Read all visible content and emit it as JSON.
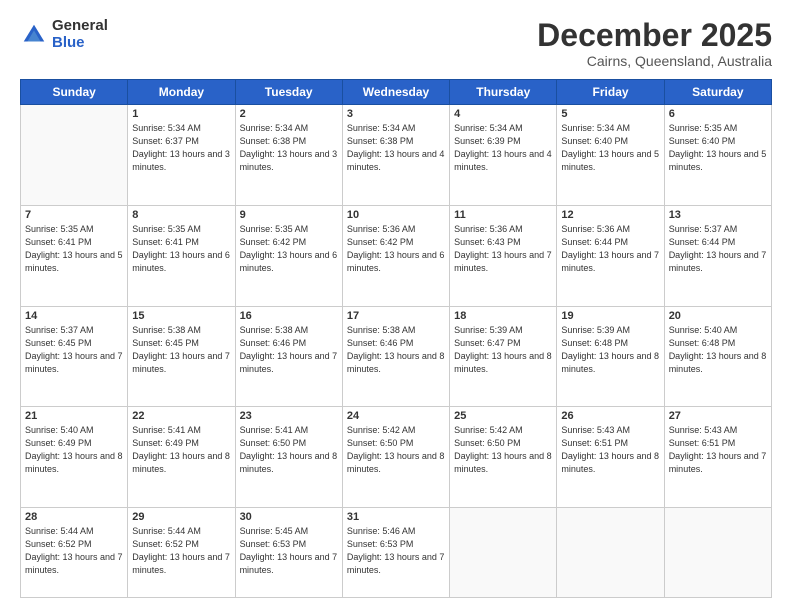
{
  "logo": {
    "general": "General",
    "blue": "Blue"
  },
  "header": {
    "month": "December 2025",
    "location": "Cairns, Queensland, Australia"
  },
  "days_of_week": [
    "Sunday",
    "Monday",
    "Tuesday",
    "Wednesday",
    "Thursday",
    "Friday",
    "Saturday"
  ],
  "weeks": [
    [
      {
        "day": "",
        "sunrise": "",
        "sunset": "",
        "daylight": ""
      },
      {
        "day": "1",
        "sunrise": "Sunrise: 5:34 AM",
        "sunset": "Sunset: 6:37 PM",
        "daylight": "Daylight: 13 hours and 3 minutes."
      },
      {
        "day": "2",
        "sunrise": "Sunrise: 5:34 AM",
        "sunset": "Sunset: 6:38 PM",
        "daylight": "Daylight: 13 hours and 3 minutes."
      },
      {
        "day": "3",
        "sunrise": "Sunrise: 5:34 AM",
        "sunset": "Sunset: 6:38 PM",
        "daylight": "Daylight: 13 hours and 4 minutes."
      },
      {
        "day": "4",
        "sunrise": "Sunrise: 5:34 AM",
        "sunset": "Sunset: 6:39 PM",
        "daylight": "Daylight: 13 hours and 4 minutes."
      },
      {
        "day": "5",
        "sunrise": "Sunrise: 5:34 AM",
        "sunset": "Sunset: 6:40 PM",
        "daylight": "Daylight: 13 hours and 5 minutes."
      },
      {
        "day": "6",
        "sunrise": "Sunrise: 5:35 AM",
        "sunset": "Sunset: 6:40 PM",
        "daylight": "Daylight: 13 hours and 5 minutes."
      }
    ],
    [
      {
        "day": "7",
        "sunrise": "Sunrise: 5:35 AM",
        "sunset": "Sunset: 6:41 PM",
        "daylight": "Daylight: 13 hours and 5 minutes."
      },
      {
        "day": "8",
        "sunrise": "Sunrise: 5:35 AM",
        "sunset": "Sunset: 6:41 PM",
        "daylight": "Daylight: 13 hours and 6 minutes."
      },
      {
        "day": "9",
        "sunrise": "Sunrise: 5:35 AM",
        "sunset": "Sunset: 6:42 PM",
        "daylight": "Daylight: 13 hours and 6 minutes."
      },
      {
        "day": "10",
        "sunrise": "Sunrise: 5:36 AM",
        "sunset": "Sunset: 6:42 PM",
        "daylight": "Daylight: 13 hours and 6 minutes."
      },
      {
        "day": "11",
        "sunrise": "Sunrise: 5:36 AM",
        "sunset": "Sunset: 6:43 PM",
        "daylight": "Daylight: 13 hours and 7 minutes."
      },
      {
        "day": "12",
        "sunrise": "Sunrise: 5:36 AM",
        "sunset": "Sunset: 6:44 PM",
        "daylight": "Daylight: 13 hours and 7 minutes."
      },
      {
        "day": "13",
        "sunrise": "Sunrise: 5:37 AM",
        "sunset": "Sunset: 6:44 PM",
        "daylight": "Daylight: 13 hours and 7 minutes."
      }
    ],
    [
      {
        "day": "14",
        "sunrise": "Sunrise: 5:37 AM",
        "sunset": "Sunset: 6:45 PM",
        "daylight": "Daylight: 13 hours and 7 minutes."
      },
      {
        "day": "15",
        "sunrise": "Sunrise: 5:38 AM",
        "sunset": "Sunset: 6:45 PM",
        "daylight": "Daylight: 13 hours and 7 minutes."
      },
      {
        "day": "16",
        "sunrise": "Sunrise: 5:38 AM",
        "sunset": "Sunset: 6:46 PM",
        "daylight": "Daylight: 13 hours and 7 minutes."
      },
      {
        "day": "17",
        "sunrise": "Sunrise: 5:38 AM",
        "sunset": "Sunset: 6:46 PM",
        "daylight": "Daylight: 13 hours and 8 minutes."
      },
      {
        "day": "18",
        "sunrise": "Sunrise: 5:39 AM",
        "sunset": "Sunset: 6:47 PM",
        "daylight": "Daylight: 13 hours and 8 minutes."
      },
      {
        "day": "19",
        "sunrise": "Sunrise: 5:39 AM",
        "sunset": "Sunset: 6:48 PM",
        "daylight": "Daylight: 13 hours and 8 minutes."
      },
      {
        "day": "20",
        "sunrise": "Sunrise: 5:40 AM",
        "sunset": "Sunset: 6:48 PM",
        "daylight": "Daylight: 13 hours and 8 minutes."
      }
    ],
    [
      {
        "day": "21",
        "sunrise": "Sunrise: 5:40 AM",
        "sunset": "Sunset: 6:49 PM",
        "daylight": "Daylight: 13 hours and 8 minutes."
      },
      {
        "day": "22",
        "sunrise": "Sunrise: 5:41 AM",
        "sunset": "Sunset: 6:49 PM",
        "daylight": "Daylight: 13 hours and 8 minutes."
      },
      {
        "day": "23",
        "sunrise": "Sunrise: 5:41 AM",
        "sunset": "Sunset: 6:50 PM",
        "daylight": "Daylight: 13 hours and 8 minutes."
      },
      {
        "day": "24",
        "sunrise": "Sunrise: 5:42 AM",
        "sunset": "Sunset: 6:50 PM",
        "daylight": "Daylight: 13 hours and 8 minutes."
      },
      {
        "day": "25",
        "sunrise": "Sunrise: 5:42 AM",
        "sunset": "Sunset: 6:50 PM",
        "daylight": "Daylight: 13 hours and 8 minutes."
      },
      {
        "day": "26",
        "sunrise": "Sunrise: 5:43 AM",
        "sunset": "Sunset: 6:51 PM",
        "daylight": "Daylight: 13 hours and 8 minutes."
      },
      {
        "day": "27",
        "sunrise": "Sunrise: 5:43 AM",
        "sunset": "Sunset: 6:51 PM",
        "daylight": "Daylight: 13 hours and 7 minutes."
      }
    ],
    [
      {
        "day": "28",
        "sunrise": "Sunrise: 5:44 AM",
        "sunset": "Sunset: 6:52 PM",
        "daylight": "Daylight: 13 hours and 7 minutes."
      },
      {
        "day": "29",
        "sunrise": "Sunrise: 5:44 AM",
        "sunset": "Sunset: 6:52 PM",
        "daylight": "Daylight: 13 hours and 7 minutes."
      },
      {
        "day": "30",
        "sunrise": "Sunrise: 5:45 AM",
        "sunset": "Sunset: 6:53 PM",
        "daylight": "Daylight: 13 hours and 7 minutes."
      },
      {
        "day": "31",
        "sunrise": "Sunrise: 5:46 AM",
        "sunset": "Sunset: 6:53 PM",
        "daylight": "Daylight: 13 hours and 7 minutes."
      },
      {
        "day": "",
        "sunrise": "",
        "sunset": "",
        "daylight": ""
      },
      {
        "day": "",
        "sunrise": "",
        "sunset": "",
        "daylight": ""
      },
      {
        "day": "",
        "sunrise": "",
        "sunset": "",
        "daylight": ""
      }
    ]
  ]
}
